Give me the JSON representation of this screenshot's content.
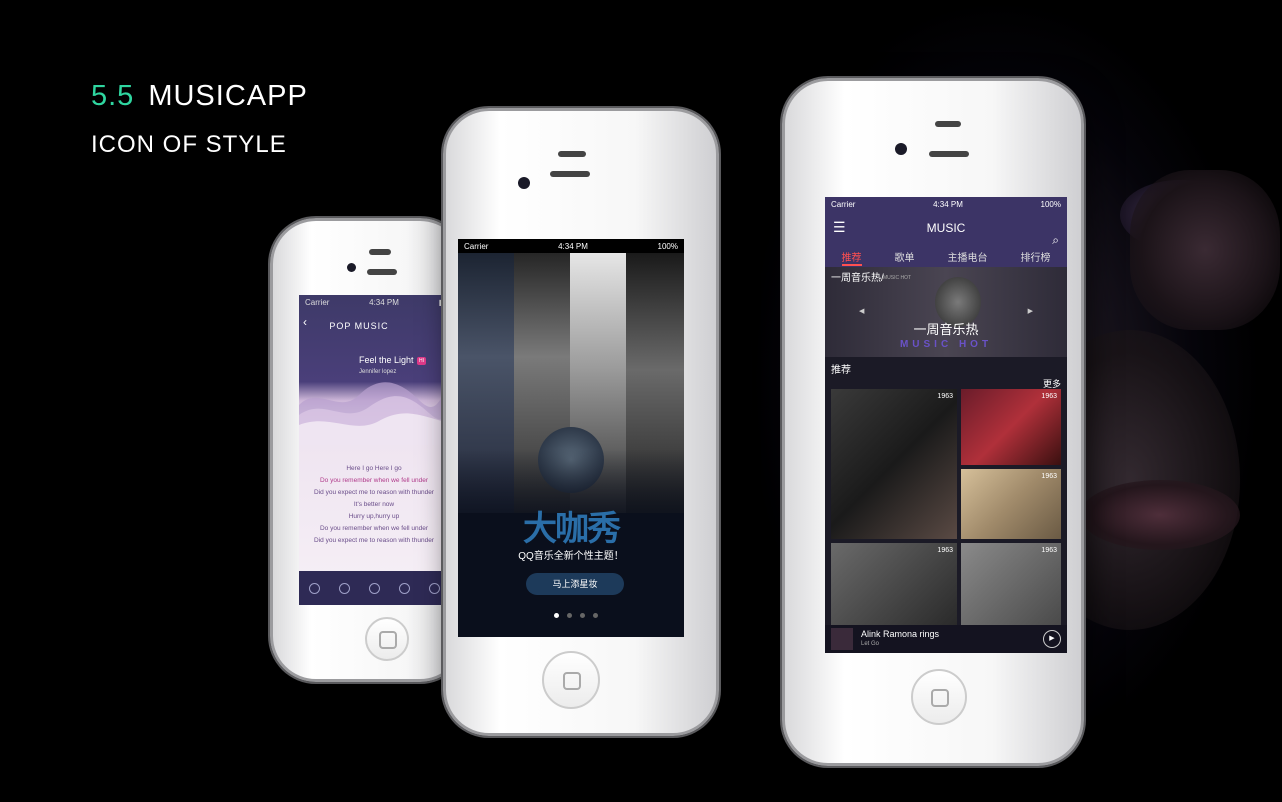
{
  "header": {
    "version": "5.5",
    "app_name": "MUSICAPP",
    "subtitle": "ICON OF STYLE"
  },
  "colors": {
    "accent": "#2fd6a0",
    "brand_purple": "#3c3466",
    "tab_active": "#ff5050"
  },
  "left_phone": {
    "carrier": "Carrier",
    "time": "4:34 PM",
    "back_icon": "chevron-left-icon",
    "title": "POP  MUSIC",
    "song": "Feel the Light",
    "badge": "HI",
    "artist": "Jennifer lopez",
    "lyrics": [
      "Here I go  Here I go",
      "Do you remember when we fell under",
      "Did you expect me to reason with thunder",
      "It's better now",
      "Hurry up,hurry up",
      "Do you remember when we fell under",
      "Did you expect me to reason with thunder"
    ]
  },
  "middle_phone": {
    "carrier": "Carrier",
    "time": "4:34 PM",
    "battery": "100%",
    "logo_text": "大咖秀",
    "tagline": "QQ音乐全新个性主题！",
    "cta": "马上添星妆"
  },
  "right_phone": {
    "carrier": "Carrier",
    "time": "4:34 PM",
    "battery": "100%",
    "title": "MUSIC",
    "tabs": [
      "推荐",
      "歌单",
      "主播电台",
      "排行榜"
    ],
    "banner_left": "一周音乐热/",
    "banner_small": "MUSIC HOT",
    "banner_center": "一周音乐热",
    "banner_bottom": "MUSIC HOT",
    "section": "推荐",
    "more": "更多",
    "year_labels": [
      "1963",
      "1963",
      "1963",
      "1963",
      "1963"
    ],
    "now_playing_title": "Alink Ramona rings",
    "now_playing_sub": "Let Go"
  }
}
